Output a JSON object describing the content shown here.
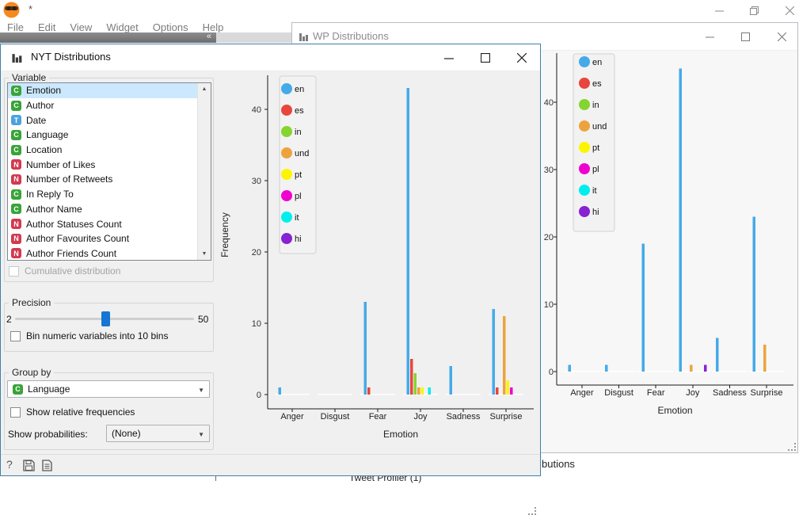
{
  "app": {
    "unsaved_indicator": "*",
    "menu": [
      "File",
      "Edit",
      "View",
      "Widget",
      "Options",
      "Help"
    ],
    "toolbar_collapse": "«",
    "window_controls": [
      "minimize",
      "restore",
      "close"
    ]
  },
  "canvas": {
    "clipped_text": "butions",
    "node_label": "Tweet Profiler (1)"
  },
  "nyt_window": {
    "title": "NYT Distributions",
    "window_controls": [
      "minimize",
      "maximize",
      "close"
    ],
    "variable_panel": {
      "label": "Variable",
      "items": [
        {
          "type": "C",
          "label": "Emotion",
          "selected": true
        },
        {
          "type": "C",
          "label": "Author"
        },
        {
          "type": "T",
          "label": "Date"
        },
        {
          "type": "C",
          "label": "Language"
        },
        {
          "type": "C",
          "label": "Location"
        },
        {
          "type": "N",
          "label": "Number of Likes"
        },
        {
          "type": "N",
          "label": "Number of Retweets"
        },
        {
          "type": "C",
          "label": "In Reply To"
        },
        {
          "type": "C",
          "label": "Author Name"
        },
        {
          "type": "N",
          "label": "Author Statuses Count"
        },
        {
          "type": "N",
          "label": "Author Favourites Count"
        },
        {
          "type": "N",
          "label": "Author Friends Count"
        }
      ],
      "cumulative_label": "Cumulative distribution"
    },
    "precision_panel": {
      "label": "Precision",
      "min": "2",
      "max": "50",
      "bin_prefix": "Bin numeric variables into",
      "bin_count": "10",
      "bin_suffix": "bins"
    },
    "groupby_panel": {
      "label": "Group by",
      "selected_type": "C",
      "selected_value": "Language",
      "relative_label": "Show relative frequencies",
      "probabilities_label": "Show probabilities:",
      "probabilities_value": "(None)"
    },
    "statusbar_icons": [
      "help",
      "save",
      "report"
    ]
  },
  "wp_window": {
    "title": "WP Distributions",
    "window_controls": [
      "minimize",
      "maximize",
      "close"
    ]
  },
  "type_colors": {
    "C": "#38a438",
    "T": "#4aa3dd",
    "N": "#d23a50"
  },
  "chart_data": [
    {
      "id": "nyt",
      "type": "bar",
      "title": "NYT Distributions",
      "categories": [
        "Anger",
        "Disgust",
        "Fear",
        "Joy",
        "Sadness",
        "Surprise"
      ],
      "series": [
        {
          "name": "en",
          "color": "#45aae8",
          "values": [
            1,
            0,
            13,
            43,
            4,
            12
          ]
        },
        {
          "name": "es",
          "color": "#e8463c",
          "values": [
            0,
            0,
            1,
            5,
            0,
            1
          ]
        },
        {
          "name": "in",
          "color": "#86d42f",
          "values": [
            0,
            0,
            0,
            3,
            0,
            0
          ]
        },
        {
          "name": "und",
          "color": "#eda33d",
          "values": [
            0,
            0,
            0,
            1,
            0,
            11
          ]
        },
        {
          "name": "pt",
          "color": "#fdf500",
          "values": [
            0,
            0,
            0,
            1,
            0,
            2
          ]
        },
        {
          "name": "pl",
          "color": "#f000cf",
          "values": [
            0,
            0,
            0,
            0,
            0,
            1
          ]
        },
        {
          "name": "it",
          "color": "#00eeee",
          "values": [
            0,
            0,
            0,
            1,
            0,
            0
          ]
        },
        {
          "name": "hi",
          "color": "#8723d2",
          "values": [
            0,
            0,
            0,
            0,
            0,
            0
          ]
        }
      ],
      "xlabel": "Emotion",
      "ylabel": "Frequency",
      "ylim": [
        0,
        45
      ],
      "yticks": [
        0,
        10,
        20,
        30,
        40
      ],
      "grid": false,
      "legend_position": "top-left"
    },
    {
      "id": "wp",
      "type": "bar",
      "title": "WP Distributions",
      "categories": [
        "Anger",
        "Disgust",
        "Fear",
        "Joy",
        "Sadness",
        "Surprise"
      ],
      "series": [
        {
          "name": "en",
          "color": "#45aae8",
          "values": [
            1,
            1,
            19,
            45,
            5,
            23
          ]
        },
        {
          "name": "es",
          "color": "#e8463c",
          "values": [
            0,
            0,
            0,
            0,
            0,
            0
          ]
        },
        {
          "name": "in",
          "color": "#86d42f",
          "values": [
            0,
            0,
            0,
            0,
            0,
            0
          ]
        },
        {
          "name": "und",
          "color": "#eda33d",
          "values": [
            0,
            0,
            0,
            1,
            0,
            4
          ]
        },
        {
          "name": "pt",
          "color": "#fdf500",
          "values": [
            0,
            0,
            0,
            0,
            0,
            0
          ]
        },
        {
          "name": "pl",
          "color": "#f000cf",
          "values": [
            0,
            0,
            0,
            0,
            0,
            0
          ]
        },
        {
          "name": "it",
          "color": "#00eeee",
          "values": [
            0,
            0,
            0,
            0,
            0,
            0
          ]
        },
        {
          "name": "hi",
          "color": "#8723d2",
          "values": [
            0,
            0,
            0,
            1,
            0,
            0
          ]
        }
      ],
      "xlabel": "Emotion",
      "ylabel": "",
      "ylim": [
        0,
        46
      ],
      "yticks": [
        0,
        10,
        20,
        30,
        40
      ],
      "grid": false,
      "legend_position": "top-left"
    }
  ]
}
